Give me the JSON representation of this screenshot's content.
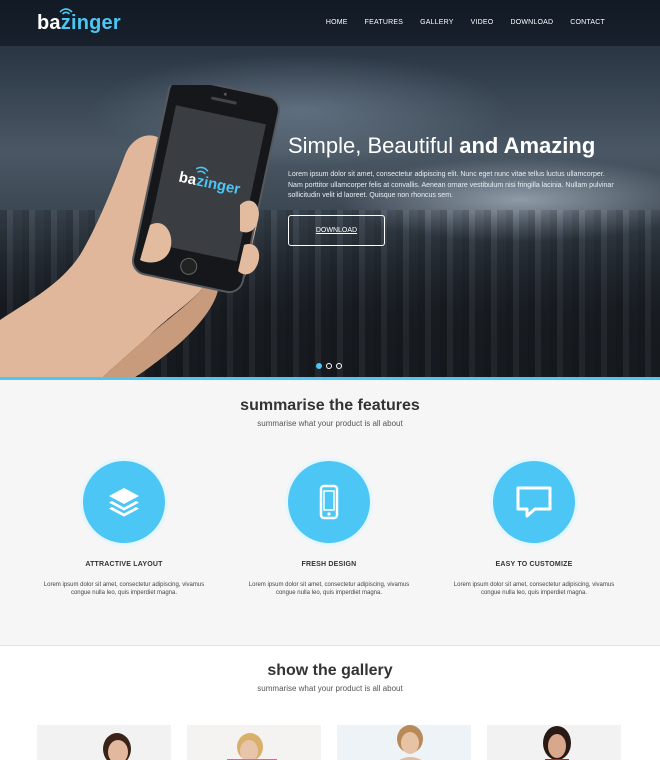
{
  "brand": {
    "part1": "ba",
    "part2": "zinger",
    "accent": "#4cc6f4"
  },
  "nav": {
    "items": [
      "HOME",
      "FEATURES",
      "GALLERY",
      "VIDEO",
      "DOWNLOAD",
      "CONTACT"
    ]
  },
  "hero": {
    "title_light": "Simple, Beautiful ",
    "title_bold": "and Amazing",
    "text": "Lorem ipsum dolor sit amet, consectetur adipiscing elit. Nunc eget nunc vitae tellus luctus ullamcorper. Nam porttitor ullamcorper felis at convallis. Aenean ornare vestibulum nisi fringilla lacinia. Nullam pulvinar sollicitudin velit id laoreet. Quisque non rhoncus sem.",
    "button": "DOWNLOAD",
    "phone_logo_a": "ba",
    "phone_logo_b": "zinger",
    "slides": 3,
    "active_slide": 1
  },
  "features": {
    "title": "summarise the features",
    "subtitle": "summarise what your product is all about",
    "items": [
      {
        "icon": "layers-icon",
        "title": "ATTRACTIVE LAYOUT",
        "text": "Lorem ipsum dolor sit amet, consectetur adipiscing, vivamus congue nulla leo, quis imperdiet magna."
      },
      {
        "icon": "mobile-icon",
        "title": "FRESH DESIGN",
        "text": "Lorem ipsum dolor sit amet, consectetur adipiscing, vivamus congue nulla leo, quis imperdiet magna."
      },
      {
        "icon": "chat-icon",
        "title": "EASY TO CUSTOMIZE",
        "text": "Lorem ipsum dolor sit amet, consectetur adipiscing, vivamus congue nulla leo, quis imperdiet magna."
      }
    ]
  },
  "gallery": {
    "title": "show the gallery",
    "subtitle": "summarise what your product is all about",
    "images": [
      "gallery-photo-1",
      "gallery-photo-2",
      "gallery-photo-3",
      "gallery-photo-4"
    ]
  }
}
